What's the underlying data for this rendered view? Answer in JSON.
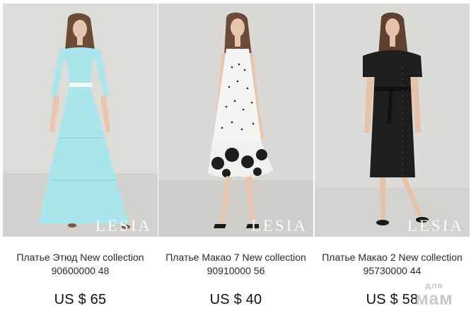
{
  "products": [
    {
      "title": "Платье Этюд New collection 90600000 48",
      "price": "US $ 65",
      "brand": "LESIA",
      "image": "model-in-turquoise-maxi-dress",
      "dress_color": "#a9e6ec"
    },
    {
      "title": "Платье Макао 7 New collection 90910000 56",
      "price": "US $ 40",
      "brand": "LESIA",
      "image": "model-in-white-polka-dot-dress",
      "dress_color": "#f4f4f2"
    },
    {
      "title": "Платье Макао 2 New collection 95730000 44",
      "price": "US $ 58",
      "brand": "LESIA",
      "image": "model-in-black-polka-dot-shirt-dress",
      "dress_color": "#1e1e1e"
    }
  ],
  "watermark": {
    "line1": "для",
    "line2": "мам"
  }
}
